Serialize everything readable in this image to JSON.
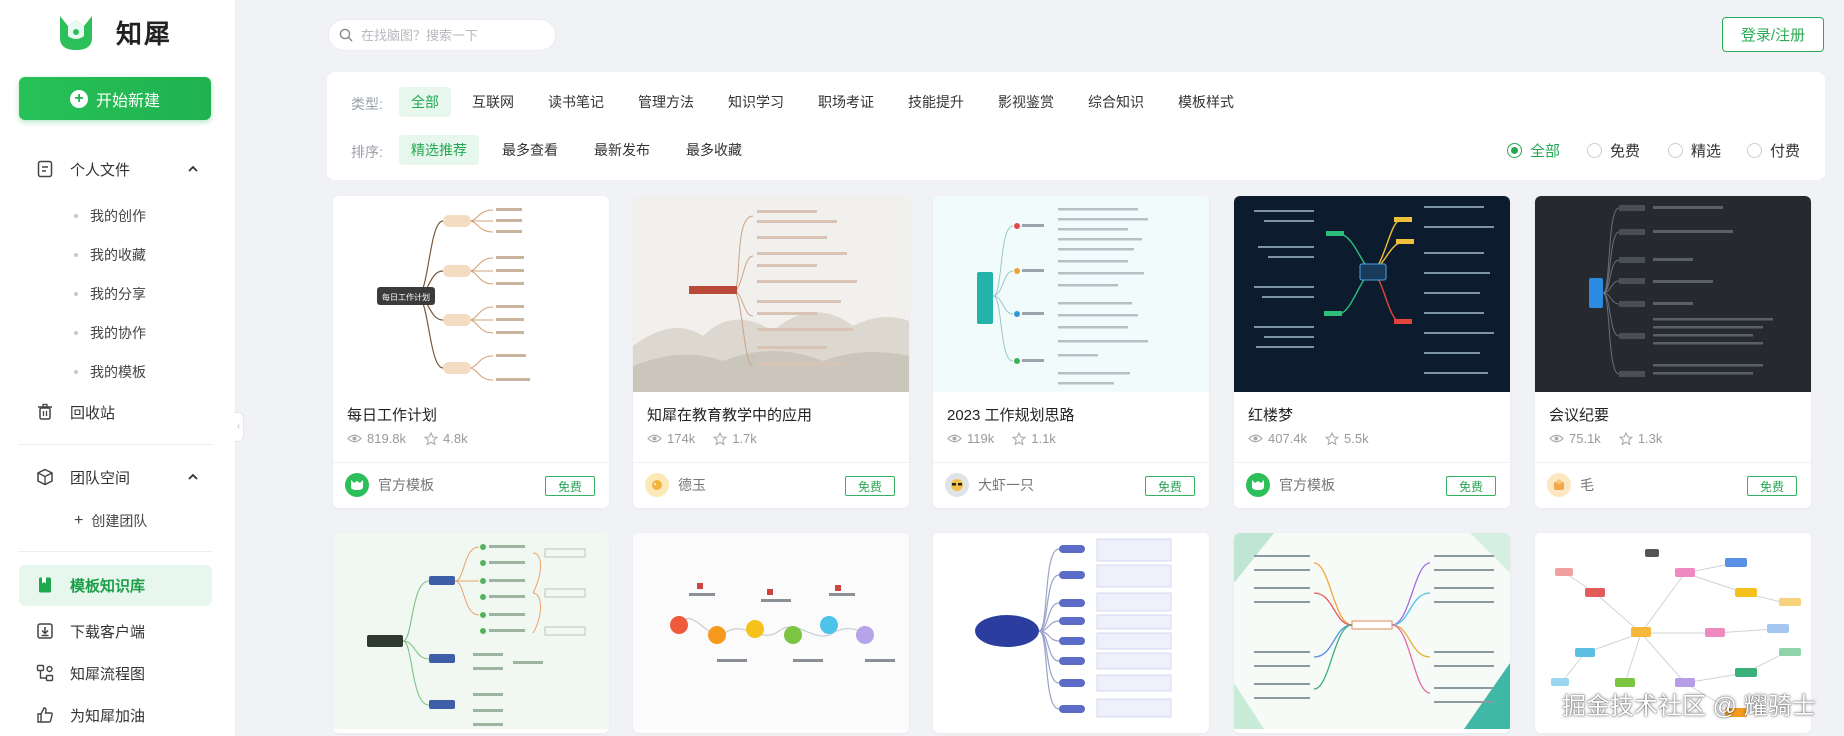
{
  "brand": {
    "name": "知犀",
    "color": "#22b24f"
  },
  "sidebar": {
    "new_button": "开始新建",
    "personal": {
      "label": "个人文件",
      "items": [
        "我的创作",
        "我的收藏",
        "我的分享",
        "我的协作",
        "我的模板"
      ]
    },
    "recycle": "回收站",
    "team": {
      "label": "团队空间",
      "create": "创建团队"
    },
    "template_library": "模板知识库",
    "download_client": "下载客户端",
    "flowchart": "知犀流程图",
    "cheer": "为知犀加油"
  },
  "header": {
    "search_placeholder": "在找脑图？搜索一下",
    "login": "登录/注册"
  },
  "filters": {
    "type_label": "类型:",
    "types": [
      "全部",
      "互联网",
      "读书笔记",
      "管理方法",
      "知识学习",
      "职场考证",
      "技能提升",
      "影视鉴赏",
      "综合知识",
      "模板样式"
    ],
    "active_type": "全部",
    "sort_label": "排序:",
    "sorts": [
      "精选推荐",
      "最多查看",
      "最新发布",
      "最多收藏"
    ],
    "active_sort": "精选推荐",
    "price_options": [
      "全部",
      "免费",
      "精选",
      "付费"
    ],
    "active_price": "全部"
  },
  "cards": [
    {
      "title": "每日工作计划",
      "views": "819.8k",
      "stars": "4.8k",
      "author": "官方模板",
      "badge": "免费",
      "center_text": "每日工作计划"
    },
    {
      "title": "知犀在教育教学中的应用",
      "views": "174k",
      "stars": "1.7k",
      "author": "德玉",
      "badge": "免费"
    },
    {
      "title": "2023 工作规划思路",
      "views": "119k",
      "stars": "1.1k",
      "author": "大虾一只",
      "badge": "免费"
    },
    {
      "title": "红楼梦",
      "views": "407.4k",
      "stars": "5.5k",
      "author": "官方模板",
      "badge": "免费"
    },
    {
      "title": "会议纪要",
      "views": "75.1k",
      "stars": "1.3k",
      "author": "毛",
      "badge": "免费"
    }
  ],
  "watermark": "掘金技术社区 @ 耀骑士"
}
